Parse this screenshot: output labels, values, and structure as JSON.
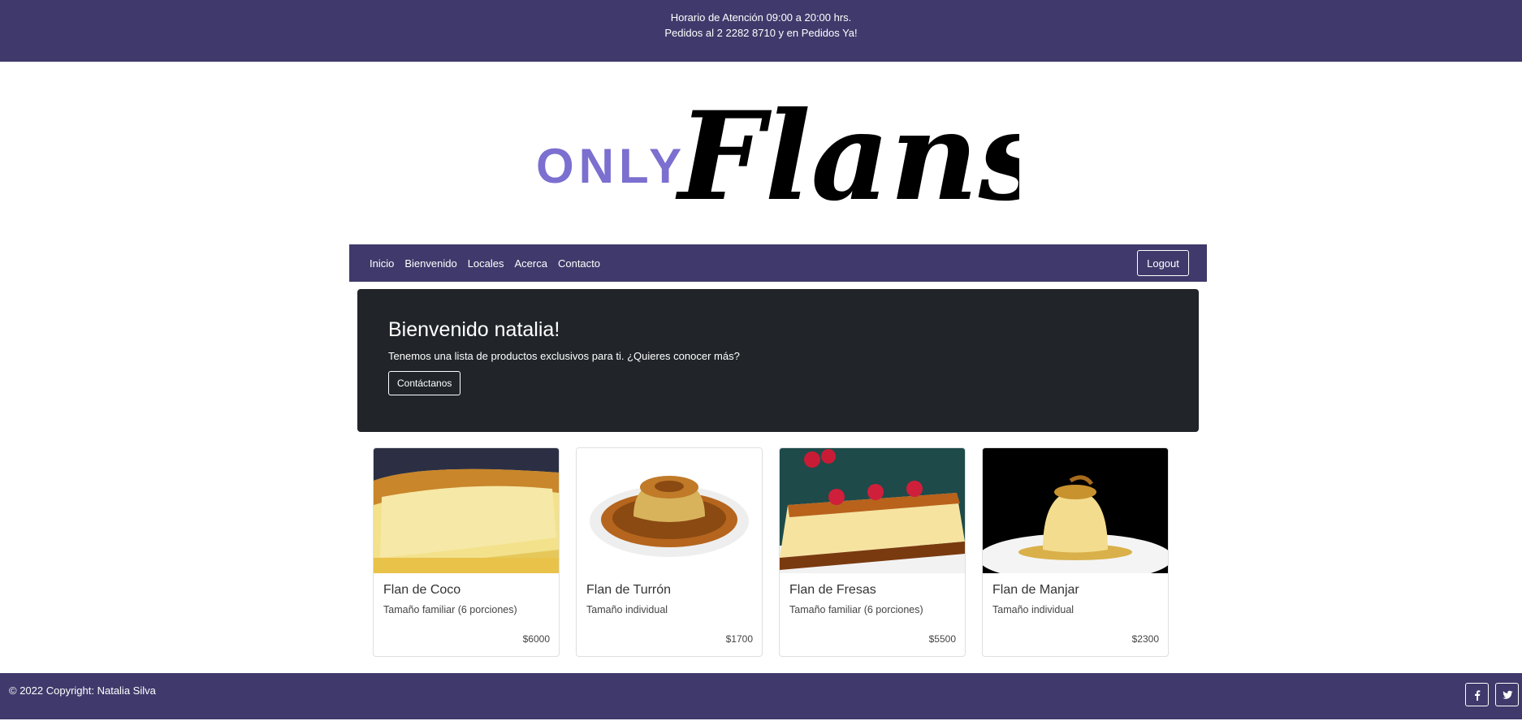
{
  "top_bar": {
    "line1": "Horario de Atención 09:00 a 20:00 hrs.",
    "line2": "Pedidos al 2 2282 8710 y en Pedidos Ya!"
  },
  "logo": {
    "word1": "ONLY",
    "word2": "Flans",
    "accent_color": "#7b6fd0"
  },
  "nav": {
    "links": [
      "Inicio",
      "Bienvenido",
      "Locales",
      "Acerca",
      "Contacto"
    ],
    "logout_label": "Logout"
  },
  "jumbotron": {
    "title": "Bienvenido natalia!",
    "text": "Tenemos una lista de productos exclusivos para ti. ¿Quieres conocer más?",
    "button_label": "Contáctanos"
  },
  "products": [
    {
      "name": "Flan de Coco",
      "description": "Tamaño familiar (6 porciones)",
      "price": "$6000"
    },
    {
      "name": "Flan de Turrón",
      "description": "Tamaño individual",
      "price": "$1700"
    },
    {
      "name": "Flan de Fresas",
      "description": "Tamaño familiar (6 porciones)",
      "price": "$5500"
    },
    {
      "name": "Flan de Manjar",
      "description": "Tamaño individual",
      "price": "$2300"
    }
  ],
  "footer": {
    "copyright": "© 2022 Copyright: Natalia Silva",
    "social_icons": [
      "facebook-icon",
      "twitter-icon"
    ]
  },
  "colors": {
    "brand_purple": "#3f3a6b",
    "jumbotron_dark": "#212529"
  }
}
